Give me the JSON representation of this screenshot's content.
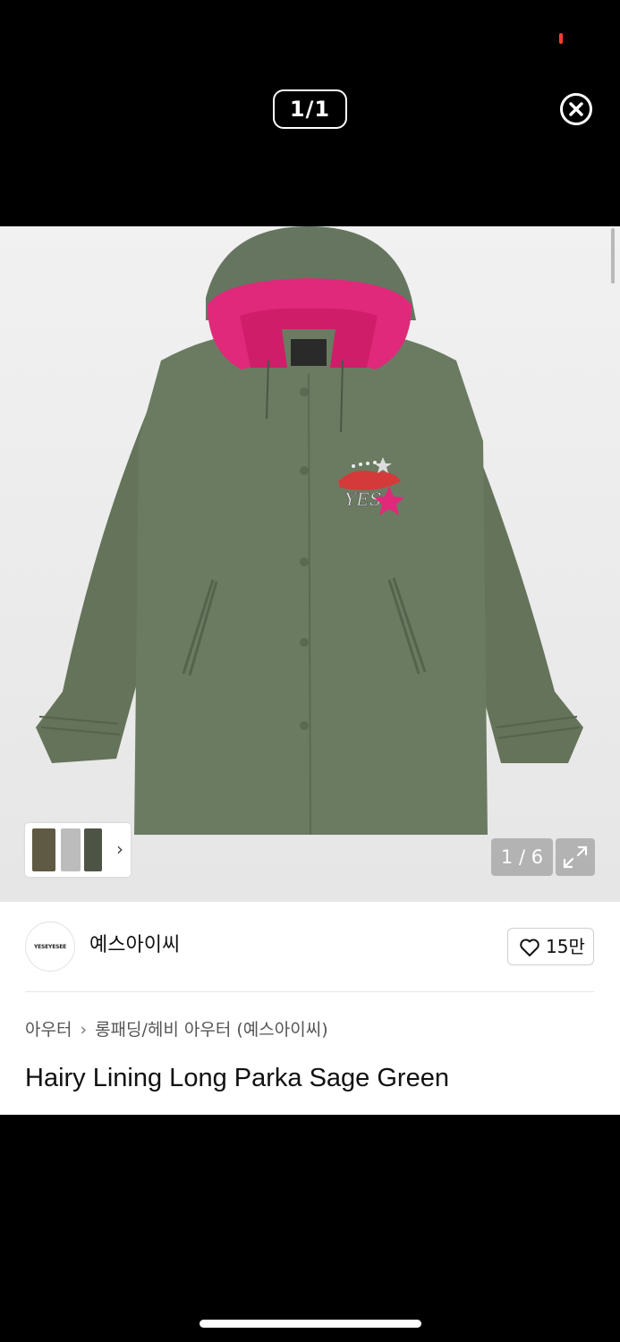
{
  "viewer": {
    "counter": "1/1",
    "close_icon": "close-circle-icon"
  },
  "colors": {
    "jacket": "#6b7b62",
    "lining": "#e0297a",
    "status_dot": "#ff3b30"
  },
  "gallery": {
    "page_indicator": "1 / 6",
    "thumb_icon": "chevron-right-icon",
    "expand_icon": "expand-icon"
  },
  "brand": {
    "logo_text": "YESEYESEE",
    "name": "예스아이씨",
    "likes": "15만"
  },
  "breadcrumb": {
    "parent": "아우터",
    "current": "롱패딩/헤비 아우터 (예스아이씨)"
  },
  "product": {
    "title": "Hairy Lining Long Parka Sage Green"
  }
}
